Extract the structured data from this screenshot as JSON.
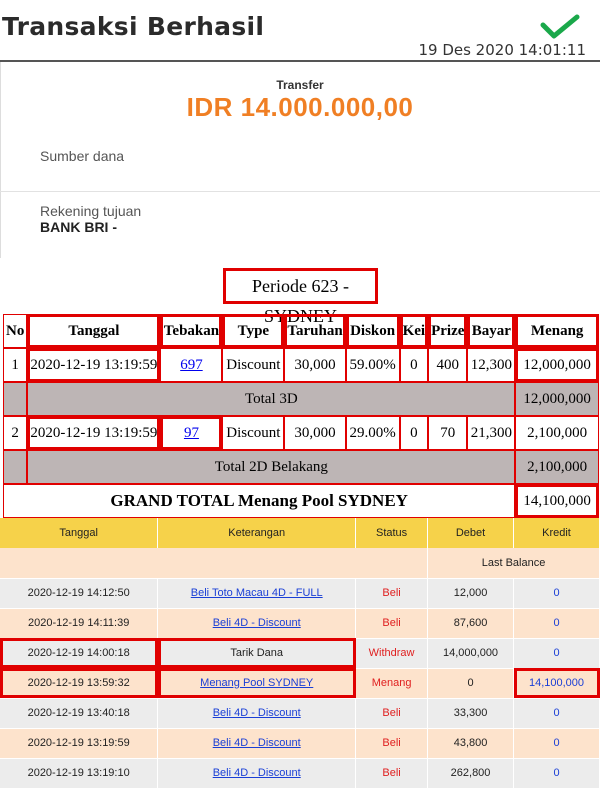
{
  "receipt": {
    "title": "Transaksi Berhasil",
    "datetime": "19 Des 2020 14:01:11",
    "transfer_label": "Transfer",
    "amount": "IDR 14.000.000,00",
    "sumber_label": "Sumber dana",
    "rekening_label": "Rekening tujuan",
    "bank": "BANK BRI -",
    "accent_color": "#f07f24",
    "check_color": "#1aa84a"
  },
  "report": {
    "periode": "Periode 623 - SYDNEY",
    "headers": [
      "No",
      "Tanggal",
      "Tebakan",
      "Type",
      "Taruhan",
      "Diskon",
      "Kei",
      "Prize",
      "Bayar",
      "Menang"
    ],
    "rows": [
      {
        "no": "1",
        "tanggal": "2020-12-19 13:19:59",
        "tebakan": "697",
        "type": "Discount",
        "taruhan": "30,000",
        "diskon": "59.00%",
        "kei": "0",
        "prize": "400",
        "bayar": "12,300",
        "menang": "12,000,000"
      },
      {
        "no": "2",
        "tanggal": "2020-12-19 13:19:59",
        "tebakan": "97",
        "type": "Discount",
        "taruhan": "30,000",
        "diskon": "29.00%",
        "kei": "0",
        "prize": "70",
        "bayar": "21,300",
        "menang": "2,100,000"
      }
    ],
    "totals": [
      {
        "label": "Total 3D",
        "value": "12,000,000"
      },
      {
        "label": "Total 2D Belakang",
        "value": "2,100,000"
      }
    ],
    "grand_label": "GRAND TOTAL  Menang Pool SYDNEY",
    "grand_value": "14,100,000",
    "highlight_color": "#e00000"
  },
  "history": {
    "headers": [
      "Tanggal",
      "Keterangan",
      "Status",
      "Debet",
      "Kredit"
    ],
    "last_balance_label": "Last Balance",
    "rows": [
      {
        "tanggal": "2020-12-19 14:12:50",
        "keterangan": "Beli Toto Macau 4D - FULL",
        "status": "Beli",
        "debet": "12,000",
        "kredit": "0"
      },
      {
        "tanggal": "2020-12-19 14:11:39",
        "keterangan": "Beli 4D - Discount",
        "status": "Beli",
        "debet": "87,600",
        "kredit": "0"
      },
      {
        "tanggal": "2020-12-19 14:00:18",
        "keterangan": "Tarik Dana",
        "status": "Withdraw",
        "debet": "14,000,000",
        "kredit": "0"
      },
      {
        "tanggal": "2020-12-19 13:59:32",
        "keterangan": "Menang Pool SYDNEY",
        "status": "Menang",
        "debet": "0",
        "kredit": "14,100,000"
      },
      {
        "tanggal": "2020-12-19 13:40:18",
        "keterangan": "Beli 4D - Discount",
        "status": "Beli",
        "debet": "33,300",
        "kredit": "0"
      },
      {
        "tanggal": "2020-12-19 13:19:59",
        "keterangan": "Beli 4D - Discount",
        "status": "Beli",
        "debet": "43,800",
        "kredit": "0"
      },
      {
        "tanggal": "2020-12-19 13:19:10",
        "keterangan": "Beli 4D - Discount",
        "status": "Beli",
        "debet": "262,800",
        "kredit": "0"
      }
    ],
    "header_color": "#f6d24a"
  }
}
